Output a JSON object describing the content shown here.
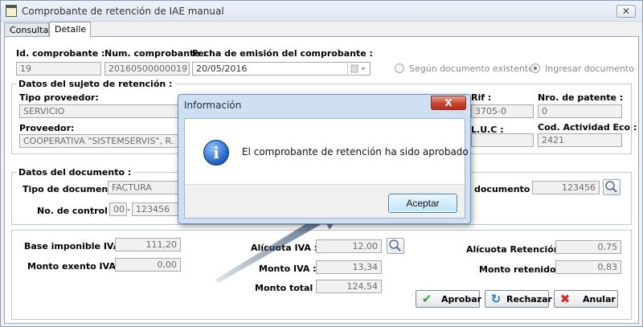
{
  "window": {
    "title": "Comprobante de retención de IAE manual",
    "close": "✕"
  },
  "tabs": [
    {
      "label": "Consulta",
      "active": false
    },
    {
      "label": "Detalle",
      "active": true
    }
  ],
  "header": {
    "id_label": "Id. comprobante :",
    "id_value": "19",
    "num_label": "Num. comprobante :",
    "num_value": "20160500000019",
    "fecha_label": "Fecha de emisión del comprobante :",
    "fecha_value": "20/05/2016",
    "radio1": "Según documento existente",
    "radio2": "Ingresar documento"
  },
  "sujeto": {
    "title": "Datos del sujeto de retención :",
    "tipo_label": "Tipo proveedor:",
    "tipo_value": "SERVICIO",
    "proveedor_label": "Proveedor:",
    "proveedor_value": "COOPERATIVA \"SISTEMSERVIS\", R.",
    "rif_label": "Rif :",
    "rif_value": "3705-0",
    "patente_label": "Nro. de patente :",
    "patente_value": "0",
    "luc_label": "L.U.C :",
    "actividad_label": "Cod. Actividad Eco :",
    "actividad_value": "2421"
  },
  "documento": {
    "title": "Datos del documento :",
    "tipo_label": "Tipo de documento:",
    "tipo_value": "FACTURA",
    "control_label": "No. de control :",
    "control_prefix": "00",
    "control_sep": "-",
    "control_value": "123456",
    "doc_label": "documento :",
    "doc_value": "123456"
  },
  "montos": {
    "base_label": "Base imponible IVA :",
    "base_value": "111,20",
    "exento_label": "Monto exento IVA :",
    "exento_value": "0,00",
    "alicuota_label": "Alícuota IVA :",
    "alicuota_value": "12,00",
    "monto_iva_label": "Monto IVA :",
    "monto_iva_value": "13,34",
    "total_label": "Monto total :",
    "total_value": "124,54",
    "ret_label": "Alícuota Retención :",
    "ret_value": "0,75",
    "retenido_label": "Monto retenido :",
    "retenido_value": "0,83"
  },
  "actions": {
    "aprobar": "Aprobar",
    "rechazar": "Rechazar",
    "anular": "Anular"
  },
  "dialog": {
    "title": "Información",
    "close": "X",
    "message": "El comprobante de retención ha sido aprobado",
    "ok": "Aceptar"
  },
  "colors": {
    "arrow": "#34506f",
    "accent": "#3c7fb1"
  }
}
